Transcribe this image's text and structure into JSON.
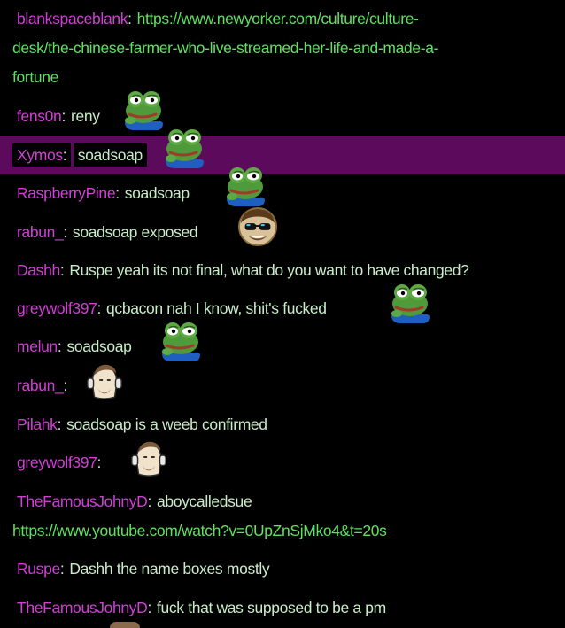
{
  "messages": [
    {
      "user": "blankspaceblank",
      "text": "",
      "link": "https://www.newyorker.com/culture/culture-",
      "link2": "desk/the-chinese-farmer-who-live-streamed-her-life-and-made-a-",
      "link3": "fortune"
    },
    {
      "user": "fens0n",
      "text": "reny",
      "emote": "pepe-frog-emote"
    },
    {
      "user": "Xymos",
      "text": "soadsoap",
      "emote": "pepe-frog-emote"
    },
    {
      "user": "RaspberryPine",
      "text": "soadsoap",
      "emote": "pepe-frog-emote"
    },
    {
      "user": "rabun_",
      "text": "soadsoap exposed",
      "emote": "sunglasses-face-emote"
    },
    {
      "user": "Dashh",
      "text": "Ruspe yeah its not final, what do you want to have changed?"
    },
    {
      "user": "greywolf397",
      "text": "qcbacon nah I know, shit's fucked",
      "emote": "pepe-frog-emote"
    },
    {
      "user": "melun",
      "text": "soadsoap",
      "emote": "pepe-frog-emote"
    },
    {
      "user": "rabun_",
      "text": "",
      "emote": "headphones-face-emote"
    },
    {
      "user": "Pilahk",
      "text": "soadsoap is a weeb confirmed"
    },
    {
      "user": "greywolf397",
      "text": "",
      "emote": "headphones-face-emote"
    },
    {
      "user": "TheFamousJohnyD",
      "text": "aboycalledsue",
      "link": "https://www.youtube.com/watch?v=0UpZnSjMko4&t=20s"
    },
    {
      "user": "Ruspe",
      "text": "Dashh the name boxes mostly"
    },
    {
      "user": "TheFamousJohnyD",
      "text": "fuck that was supposed to be a pm"
    }
  ],
  "colors": {
    "background": "#000000",
    "username": "#d13fd6",
    "text": "#c9ecc9",
    "link": "#5fe15f",
    "highlight": "#5c0a5c"
  }
}
